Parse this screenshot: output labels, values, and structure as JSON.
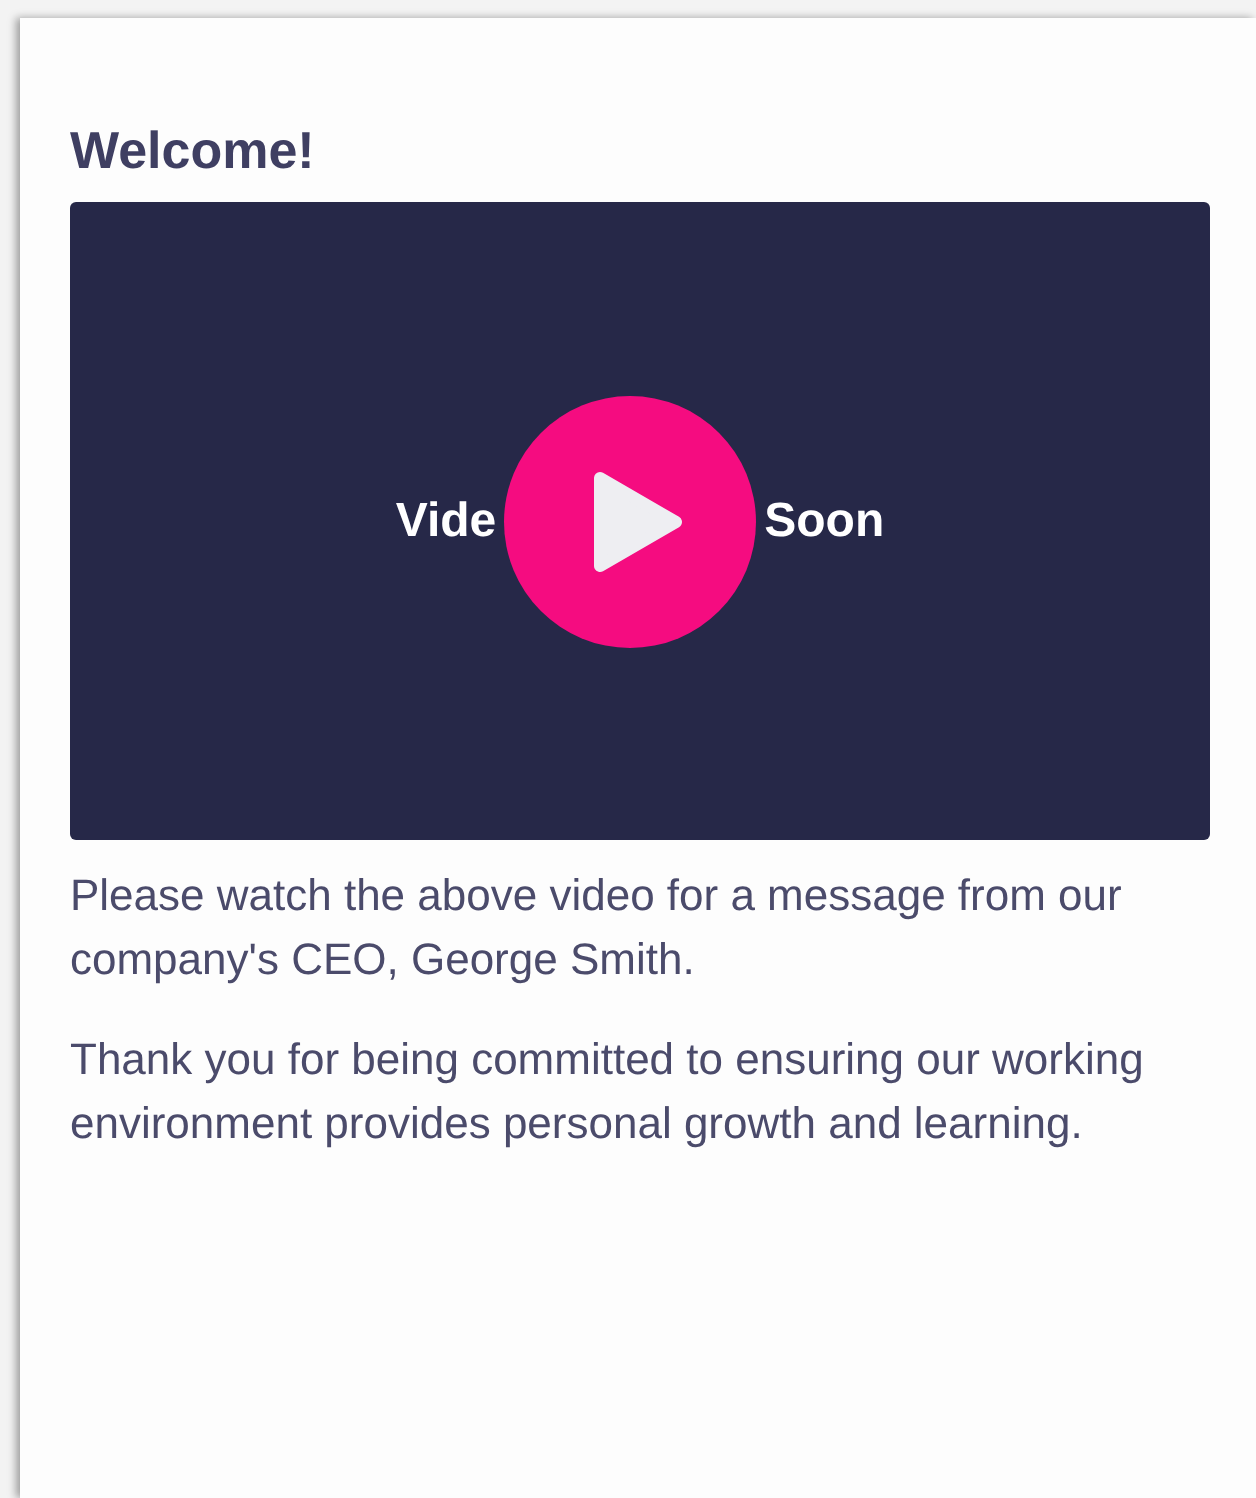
{
  "title": "Welcome!",
  "video": {
    "caption_left": "Vide",
    "caption_right": "Soon"
  },
  "paragraphs": [
    "Please watch the above video for a message from our company's CEO, George Smith.",
    "Thank you for being committed to ensuring our working environment provides personal growth and learning."
  ]
}
